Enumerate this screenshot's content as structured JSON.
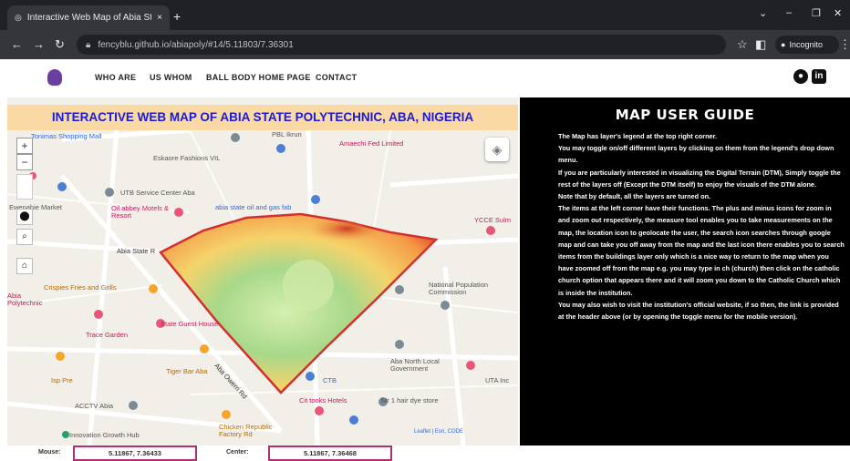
{
  "browser": {
    "tab_title": "Interactive Web Map of Abia St",
    "tab_close": "×",
    "new_tab": "+",
    "url": "fencyblu.github.io/abiapoly/#14/5.11803/7.36301",
    "incognito_label": "Incognito"
  },
  "header": {
    "nav": [
      "WHO ARE",
      "US WHOM",
      "BALL BODY HOME PAGE",
      "CONTACT"
    ]
  },
  "map": {
    "title": "INTERACTIVE WEB MAP OF ABIA STATE POLYTECHNIC, ABA, NIGERIA",
    "zoom_in": "+",
    "zoom_out": "−",
    "labels": {
      "shopping": "Tonimas Shopping Mall",
      "fashion": "Eskaore Fashions VIL",
      "amaechi": "Amaechi Fed Limited",
      "pbl": "PBL Ikrun",
      "utb": "UTB Service Center Aba",
      "oilabbey": "Oil abbey Motels & Resort",
      "abia_oil": "abia state oil and gas fab",
      "ewm": "Ewenahie Market",
      "abia_rd": "Abia State R",
      "polytechnic_rd": "Aba Owerri Rd",
      "ycce": "YCCE Sulm",
      "national": "National Population Commission",
      "grill": "Crispies Fries and Grills",
      "trace": "Trace Garden",
      "guest": "State Guest House",
      "tiger": "Tiger Bar Aba",
      "local_govt": "Aba North Local Government",
      "ctb": "CTB",
      "acctv": "ACCTV Abia",
      "innovation": "Innovation Growth Hub",
      "crestline": "Cit tooks Hotels",
      "chicken": "Chicken Republic Factory Rd",
      "mr": "Mr 1 hair dye store",
      "uta": "UTA Inc",
      "isp": "Isp Pre",
      "abia_left": "Abia Polytechnic"
    },
    "attribution": "Leaflet | Esri, CODE"
  },
  "guide": {
    "title": "MAP USER GUIDE",
    "paragraphs": [
      "The Map has layer's legend at the top right corner.",
      "You may toggle on/off different layers by clicking on them from the legend's drop down menu.",
      "If you are particularly interested in visualizing the Digital Terrain (DTM), Simply toggle the rest of the layers off (Except the DTM itself) to enjoy the visuals of the DTM alone.",
      "Note that by default, all the layers are turned on.",
      "The items at the left corner have their functions. The plus and minus icons for zoom in and zoom out respectively, the measure tool enables you to take measurements on the map, the location icon to geolocate the user, the search icon searches through google map and can take you off away from the map and the last icon there enables you to search items from the buildings layer only which is a nice way to return to the map when you have zoomed off from the map e.g. you may type in ch (church) then click on the catholic church option that appears there and it will zoom you down to the Catholic Church which is inside the institution.",
      "You may also wish to visit the institution's official website, if so then, the link is provided at the header above (or by opening the toggle menu for the mobile version)."
    ]
  },
  "footer": {
    "mouse_label": "Mouse:",
    "mouse_value": "5.11867, 7.36433",
    "center_label": "Center:",
    "center_value": "5.11867, 7.36468"
  },
  "colors": {
    "title_bg": "#fbd9a5",
    "title_text": "#1a1ad8",
    "boundary": "#d32f2f",
    "guide_bg": "#000000",
    "coord_border": "#b0306f"
  }
}
